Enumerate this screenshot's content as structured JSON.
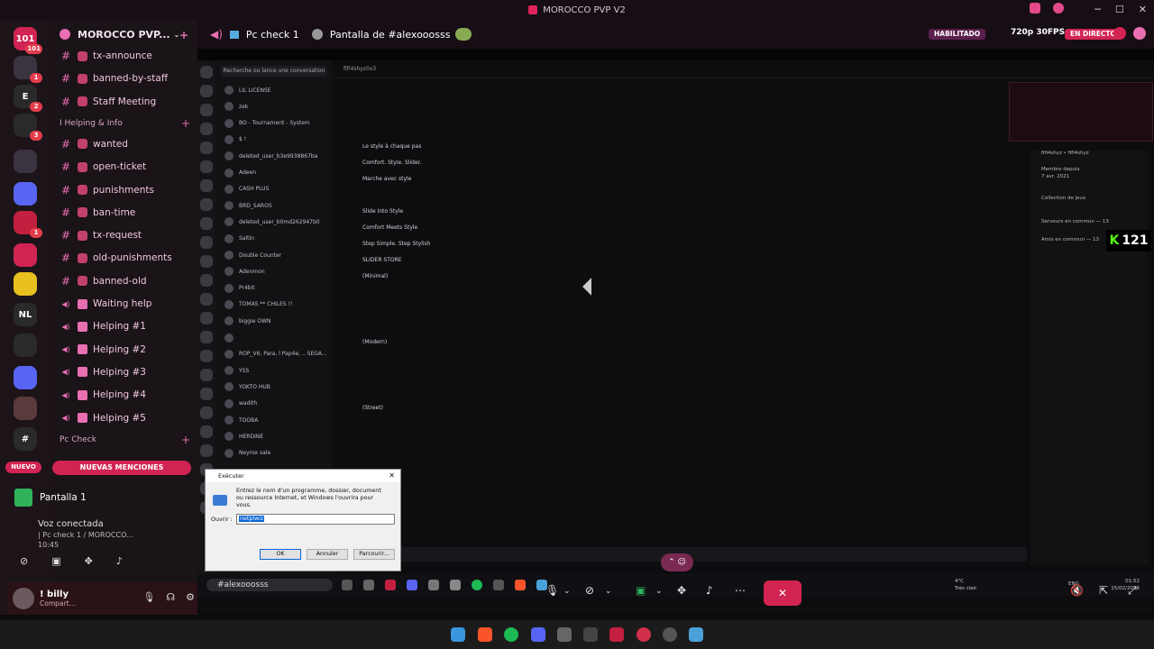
{
  "window": {
    "title": "MOROCCO PVP V2"
  },
  "servers": [
    {
      "label": "101",
      "badge": "101",
      "color": "#d22452"
    },
    {
      "label": "",
      "badge": "1",
      "color": "#3a3340"
    },
    {
      "label": "E",
      "badge": "2",
      "color": "#2a2a2a"
    },
    {
      "label": "",
      "badge": "3",
      "color": "#2a2a2a"
    },
    {
      "label": "",
      "badge": "",
      "color": "#3a3340"
    },
    {
      "label": "",
      "badge": "",
      "color": "#5865f2"
    },
    {
      "label": "",
      "badge": "1",
      "color": "#c2203e"
    },
    {
      "label": "",
      "badge": "",
      "color": "#d22452"
    },
    {
      "label": "",
      "badge": "",
      "color": "#e8c020"
    },
    {
      "label": "NL",
      "badge": "",
      "color": "#2a2a2a"
    },
    {
      "label": "",
      "badge": "",
      "color": "#2a2a2a"
    },
    {
      "label": "",
      "badge": "",
      "color": "#5865f2"
    },
    {
      "label": "",
      "badge": "",
      "color": "#5a3a3a"
    },
    {
      "label": "#",
      "badge": "",
      "color": "#2a2a2a"
    }
  ],
  "guild": {
    "name": "MOROCCO PVP..."
  },
  "channels": [
    {
      "type": "text",
      "name": "tx-announce"
    },
    {
      "type": "text",
      "name": "banned-by-staff"
    },
    {
      "type": "text",
      "name": "Staff Meeting"
    },
    {
      "type": "category",
      "name": "I Helping & Info"
    },
    {
      "type": "text",
      "name": "wanted"
    },
    {
      "type": "text",
      "name": "open-ticket"
    },
    {
      "type": "text",
      "name": "punishments"
    },
    {
      "type": "text",
      "name": "ban-time"
    },
    {
      "type": "text",
      "name": "tx-request"
    },
    {
      "type": "text",
      "name": "old-punishments"
    },
    {
      "type": "text",
      "name": "banned-old"
    },
    {
      "type": "voice",
      "name": "Waiting help"
    },
    {
      "type": "voice",
      "name": "Helping #1"
    },
    {
      "type": "voice",
      "name": "Helping #2"
    },
    {
      "type": "voice",
      "name": "Helping #3"
    },
    {
      "type": "voice",
      "name": "Helping #4"
    },
    {
      "type": "voice",
      "name": "Helping #5"
    },
    {
      "type": "category",
      "name": "Pc Check"
    }
  ],
  "mentions": {
    "new_label": "NUEVO",
    "banner": "NUEVAS MENCIONES"
  },
  "voice": {
    "screen_label": "Pantalla 1",
    "status": "Voz conectada",
    "channel": "| Pc check 1 / MOROCCO...",
    "time": "10:45"
  },
  "user": {
    "name": "! billy",
    "status": "Compart..."
  },
  "stream_header": {
    "channel": "Pc check 1",
    "screen_of": "Pantalla de #alexooosss",
    "enabled": "HABILITADO",
    "quality": "720p 30FPS",
    "live": "EN DIRECTO"
  },
  "shared": {
    "dm_search": "Recherche ou lance une conversation",
    "chat_user": "fifi4shyz0x3",
    "dms": [
      "LIL LICENSE",
      "zek",
      "BO - Tournament - System",
      "$ !",
      "deleted_user_b3e9938867ba",
      "Adeen",
      "CASH PLUS",
      "BRD_SAROS",
      "deleted_user_b0md262947b0",
      "Saltin",
      "Double Counter",
      "Adenmon",
      "Pr4bit",
      "TOMAS ** CHILES !!",
      "biggie OWN",
      "",
      "ROP_V6, Para, l Pap4e, .. SEGA...",
      "YSS",
      "YOKTO HUB",
      "wadith",
      "TOOBA",
      "HERDINE",
      "Neyrox sale"
    ],
    "messages": [
      "Le style à chaque pas",
      "Comfort. Style. Slider.",
      "Marche avec style",
      "Slide Into Style",
      "Comfort Meets Style",
      "Step Simple. Step Stylish",
      "SLIDER STORE",
      "(Minimal)",
      "(Modern)",
      "(Street)"
    ],
    "right_panel": [
      "fifi4shyz • fifi4shyz",
      "Membre depuis",
      "7 avr. 2021",
      "Collection de jeux",
      "Serveurs en commun — 13",
      "Amis en commun — 13"
    ],
    "kick": {
      "k": "K",
      "count": "121"
    },
    "taskbar_search": "#alexooosss",
    "clock": {
      "time": "01:52",
      "date": "15/02/2026"
    },
    "weather": {
      "temp": "4°C",
      "cond": "Très clair"
    },
    "lang": "ENG"
  },
  "run_dialog": {
    "title": "Exécuter",
    "description": "Entrez le nom d'un programme, dossier, document ou ressource Internet, et Windows l'ouvrira pour vous.",
    "label": "Ouvrir :",
    "value": "netplwiz",
    "ok": "OK",
    "cancel": "Annuler",
    "browse": "Parcourir..."
  },
  "colors": {
    "accent": "#e86fb1",
    "live": "#d22452",
    "enabled": "#5b1f4d"
  }
}
